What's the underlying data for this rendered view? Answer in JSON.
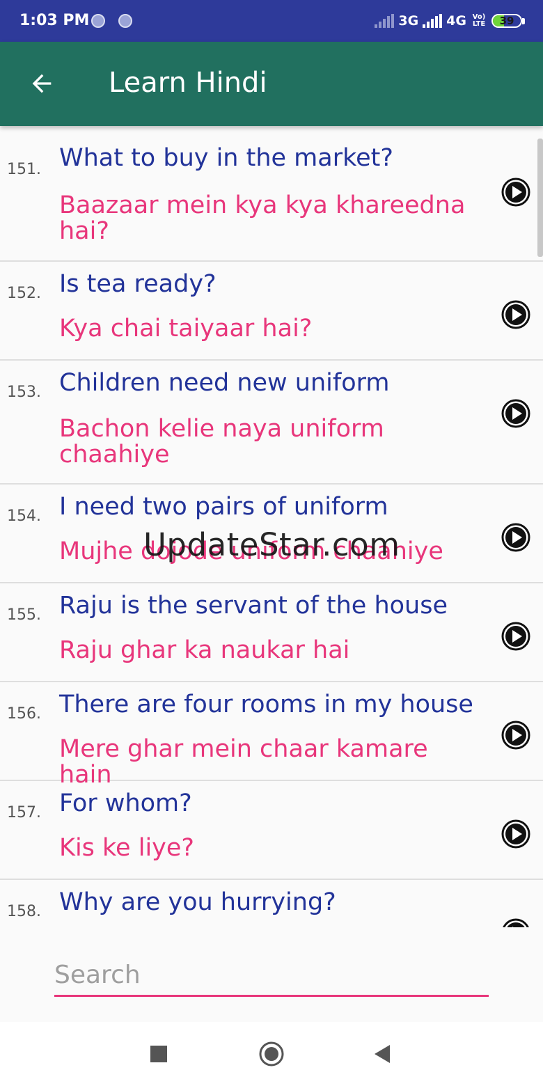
{
  "status_bar": {
    "time": "1:03 PM",
    "network_1": "3G",
    "network_2": "4G",
    "volte": "Vo) LTE",
    "battery": "39",
    "battery_level": 0.39
  },
  "app_bar": {
    "back_icon": "arrow-left-icon",
    "title": "Learn Hindi"
  },
  "phrases": [
    {
      "num": "151.",
      "english": "What to buy in the market?",
      "hindi": "Baazaar mein kya kya khareedna hai?"
    },
    {
      "num": "152.",
      "english": "Is tea ready?",
      "hindi": "Kya chai taiyaar hai?"
    },
    {
      "num": "153.",
      "english": "Children need new uniform",
      "hindi": "Bachon kelie naya uniform chaahiye"
    },
    {
      "num": "154.",
      "english": "I need two pairs of uniform",
      "hindi": "Mujhe dojode uniform chaahiye"
    },
    {
      "num": "155.",
      "english": "Raju is the servant of the house",
      "hindi": "Raju ghar ka naukar hai"
    },
    {
      "num": "156.",
      "english": "There are four rooms in my house",
      "hindi": "Mere ghar mein chaar kamare hain"
    },
    {
      "num": "157.",
      "english": "For whom?",
      "hindi": "Kis ke liye?"
    },
    {
      "num": "158.",
      "english": "Why are you hurrying?",
      "hindi": ""
    }
  ],
  "watermark": "UpdateStar.com",
  "search": {
    "placeholder": "Search",
    "value": ""
  },
  "nav_bar": {
    "icons": [
      "square-recents-icon",
      "circle-home-icon",
      "triangle-back-icon"
    ]
  },
  "colors": {
    "status_bar": "#2e3a9a",
    "app_bar": "#21705f",
    "english_text": "#223399",
    "hindi_text": "#e8367b",
    "accent": "#e8367b"
  }
}
